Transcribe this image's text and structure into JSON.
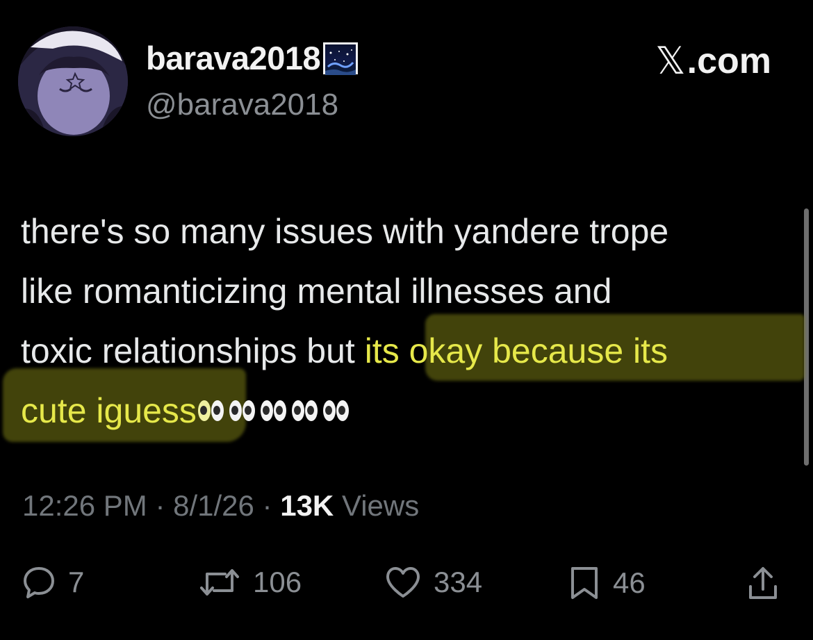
{
  "header": {
    "display_name": "barava2018",
    "handle": "@barava2018",
    "brand": ".com",
    "icons": {
      "avatar": "avatar",
      "badge": "night-sky-emoji-icon",
      "brand": "x-logo-icon"
    }
  },
  "tweet": {
    "lines": [
      "there's so many issues with yandere trope",
      "like romanticizing mental illnesses and",
      "toxic relationships but "
    ],
    "highlight_part1": "its okay because its",
    "highlight_part2": "cute iguess",
    "emoji": "eyes-emoji-icon",
    "emoji_count": 5,
    "highlight_color": "#e6e84a"
  },
  "meta": {
    "time": "12:26 PM",
    "sep1": " · ",
    "date": "8/1/26",
    "sep2": " · ",
    "views_count": "13K",
    "views_label": " Views"
  },
  "actions": {
    "reply_count": "7",
    "repost_count": "106",
    "like_count": "334",
    "bookmark_count": "46",
    "icons": [
      "reply-icon",
      "repost-icon",
      "like-icon",
      "bookmark-icon",
      "share-icon"
    ]
  },
  "colors": {
    "background": "#000000",
    "text": "#e7e9ea",
    "muted": "#71767b",
    "highlight_text": "#e6e84a"
  }
}
